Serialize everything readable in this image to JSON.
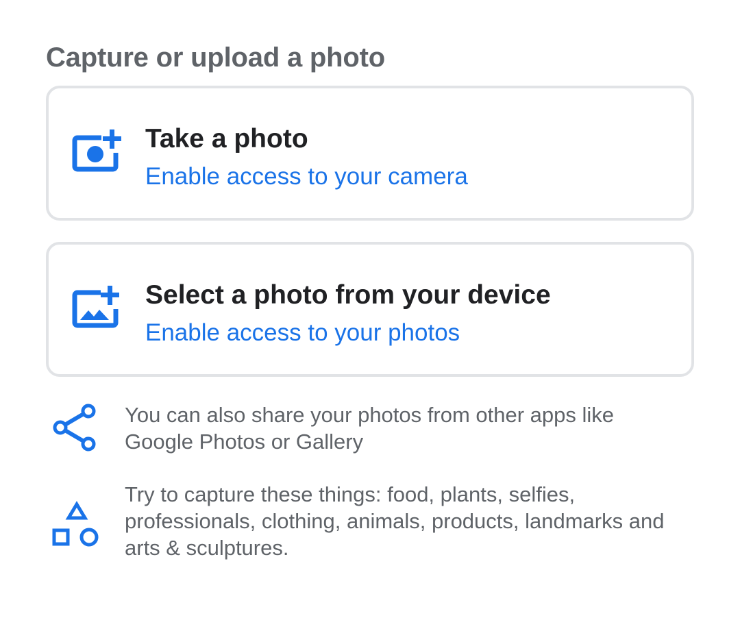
{
  "header": {
    "title": "Capture or upload a photo"
  },
  "options": [
    {
      "icon": "add-camera-icon",
      "title": "Take a photo",
      "subtitle": "Enable access to your camera"
    },
    {
      "icon": "add-photo-icon",
      "title": "Select a photo from your device",
      "subtitle": "Enable access to your photos"
    }
  ],
  "info": {
    "share": {
      "icon": "share-icon",
      "text": "You can also share your photos from other apps like Google Photos or Gallery"
    },
    "things": {
      "icon": "shapes-icon",
      "text": "Try to capture these things: food, plants, selfies, professionals, clothing, animals, products, landmarks and arts & sculptures."
    }
  },
  "colors": {
    "accent": "#1a73e8",
    "title_text": "#202124",
    "secondary_text": "#5f6368",
    "card_border": "#e1e3e6"
  }
}
